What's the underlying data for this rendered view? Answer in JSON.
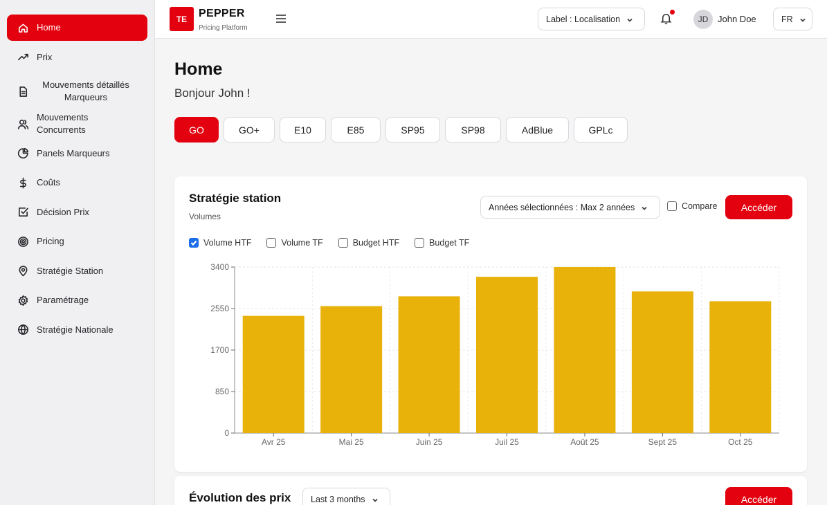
{
  "app": {
    "logo_text": "TE",
    "name": "PEPPER",
    "subtitle": "Pricing Platform"
  },
  "sidebar": {
    "items": [
      {
        "label": "Home",
        "icon": "home-icon",
        "active": true
      },
      {
        "label": "Prix",
        "icon": "trending-up-icon"
      },
      {
        "label": "Mouvements détaillés Marqueurs",
        "icon": "document-icon"
      },
      {
        "label": "Mouvements Concurrents",
        "icon": "users-icon"
      },
      {
        "label": "Panels Marqueurs",
        "icon": "pie-chart-icon"
      },
      {
        "label": "Coûts",
        "icon": "dollar-icon"
      },
      {
        "label": "Décision Prix",
        "icon": "checkbox-icon"
      },
      {
        "label": "Pricing",
        "icon": "target-icon"
      },
      {
        "label": "Stratégie Station",
        "icon": "map-pin-icon"
      },
      {
        "label": "Paramétrage",
        "icon": "settings-icon"
      },
      {
        "label": "Stratégie Nationale",
        "icon": "globe-icon"
      }
    ]
  },
  "topbar": {
    "location_select": "Label : Localisation",
    "user_initials": "JD",
    "user_name": "John Doe",
    "language": "FR"
  },
  "main": {
    "title": "Home",
    "greeting": "Bonjour John !",
    "fuel_tabs": [
      "GO",
      "GO+",
      "E10",
      "E85",
      "SP95",
      "SP98",
      "AdBlue",
      "GPLc"
    ],
    "active_fuel": "GO"
  },
  "strategy_card": {
    "title": "Stratégie station",
    "subtitle": "Volumes",
    "years_select": "Années sélectionnées : Max 2 années",
    "compare_label": "Compare",
    "compare_checked": false,
    "access_button": "Accéder",
    "series_toggles": [
      {
        "label": "Volume HTF",
        "checked": true
      },
      {
        "label": "Volume TF",
        "checked": false
      },
      {
        "label": "Budget HTF",
        "checked": false
      },
      {
        "label": "Budget TF",
        "checked": false
      }
    ]
  },
  "chart_data": {
    "type": "bar",
    "categories": [
      "Avr 25",
      "Mai 25",
      "Juin 25",
      "Juil 25",
      "Août 25",
      "Sept 25",
      "Oct 25"
    ],
    "series": [
      {
        "values": [
          2400,
          2600,
          2800,
          3200,
          3400,
          2900,
          2700
        ],
        "color": "#e8b20b"
      }
    ],
    "yticks": [
      0,
      850,
      1700,
      2550,
      3400
    ],
    "ylim": [
      0,
      3400
    ],
    "grid": true
  },
  "prices_card": {
    "title": "Évolution des prix",
    "period_select": "Last 3 months",
    "access_button": "Accéder"
  },
  "colors": {
    "accent": "#e3000f",
    "bar": "#e8b20b",
    "checkbox": "#1c6ee8"
  }
}
